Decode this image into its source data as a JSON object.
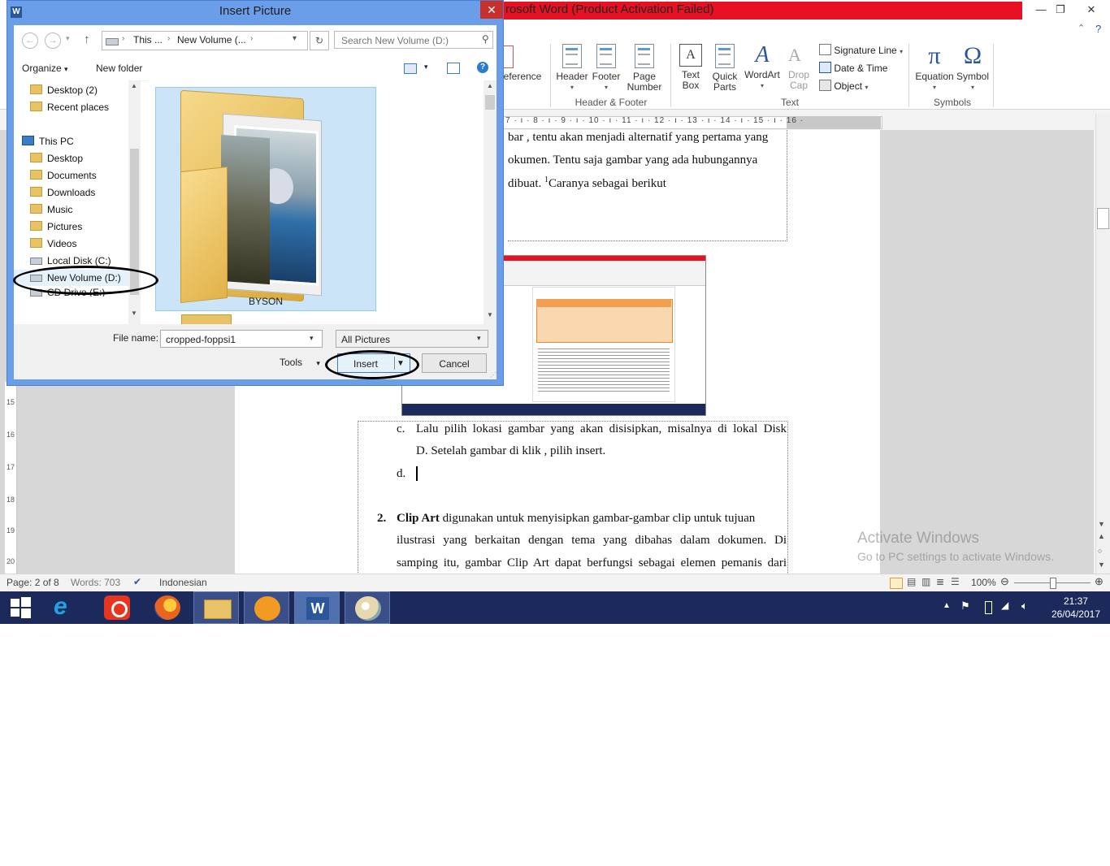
{
  "word": {
    "title_partial": "rosoft Word (Product Activation Failed)",
    "ribbon": {
      "partial_reference": "eference",
      "header_footer_group": {
        "label": "Header & Footer",
        "buttons": [
          "Header",
          "Footer",
          "Page",
          "Number"
        ]
      },
      "text_group": {
        "label": "Text",
        "text_box": [
          "Text",
          "Box"
        ],
        "quick_parts": [
          "Quick",
          "Parts"
        ],
        "wordart": "WordArt",
        "drop_cap": [
          "Drop",
          "Cap"
        ],
        "signature_line": "Signature Line",
        "date_time": "Date & Time",
        "object": "Object"
      },
      "symbols_group": {
        "label": "Symbols",
        "equation": "Equation",
        "symbol": "Symbol"
      }
    },
    "ruler_marks": "· 7 · ı · 8 · ı · 9 · ı · 10 · ı · 11 · ı · 12 · ı · 13 · ı · 14 · ı · 15 · ı · 16 ·",
    "vruler_marks": [
      "15",
      "16",
      "17",
      "18",
      "19",
      "20"
    ],
    "document": {
      "line1": "bar , tentu akan menjadi alternatif yang pertama yang",
      "line2": "okumen. Tentu saja gambar yang ada hubungannya",
      "line3_pre": "dibuat. ",
      "line3_sup": "1",
      "line3_post": "Caranya sebagai berikut",
      "item_c_marker": "c.",
      "item_c_line1": "Lalu pilih lokasi gambar yang akan disisipkan, misalnya di lokal Disk",
      "item_c_line2": "D. Setelah gambar di klik , pilih insert.",
      "item_d_marker": "d.",
      "item2_marker": "2.",
      "item2_bold": "Clip Art",
      "item2_line1": " digunakan untuk menyisipkan gambar-gambar clip untuk tujuan",
      "item2_line2": "ilustrasi yang berkaitan dengan tema yang dibahas dalam dokumen. Di",
      "item2_line3": "samping itu, gambar Clip Art dapat berfungsi sebagai elemen pemanis dari"
    },
    "watermark": {
      "line1": "Activate Windows",
      "line2": "Go to PC settings to activate Windows."
    },
    "status": {
      "page": "Page: 2 of 8",
      "words": "Words: 703",
      "language": "Indonesian",
      "zoom": "100%"
    }
  },
  "dialog": {
    "title": "Insert Picture",
    "close_label": "✕",
    "address": [
      "This ...",
      "New Volume (..."
    ],
    "search_placeholder": "Search New Volume (D:)",
    "organize": "Organize",
    "new_folder": "New folder",
    "nav_items": [
      {
        "label": "Desktop (2)",
        "icon": "folder"
      },
      {
        "label": "Recent places",
        "icon": "folder"
      },
      {
        "label": "This PC",
        "icon": "pc"
      },
      {
        "label": "Desktop",
        "icon": "folder"
      },
      {
        "label": "Documents",
        "icon": "folder"
      },
      {
        "label": "Downloads",
        "icon": "folder"
      },
      {
        "label": "Music",
        "icon": "folder"
      },
      {
        "label": "Pictures",
        "icon": "folder"
      },
      {
        "label": "Videos",
        "icon": "folder"
      },
      {
        "label": "Local Disk (C:)",
        "icon": "drive"
      },
      {
        "label": "New Volume (D:)",
        "icon": "drive"
      },
      {
        "label": "CD Drive (E:)",
        "icon": "drive"
      }
    ],
    "folder_tile_name": "BYSON",
    "file_name_label": "File name:",
    "file_name_value": "cropped-foppsi1",
    "file_type": "All Pictures",
    "tools_label": "Tools",
    "insert_label": "Insert",
    "cancel_label": "Cancel"
  },
  "taskbar": {
    "apps": [
      "start",
      "internet-explorer",
      "app-red",
      "firefox",
      "file-explorer",
      "uc-browser",
      "word",
      "paint"
    ],
    "time": "21:37",
    "date": "26/04/2017"
  },
  "colors": {
    "title_red": "#e81123",
    "dialog_frame": "#6b9ee8",
    "taskbar": "#1b2a5b",
    "selection": "#cce4f7"
  }
}
